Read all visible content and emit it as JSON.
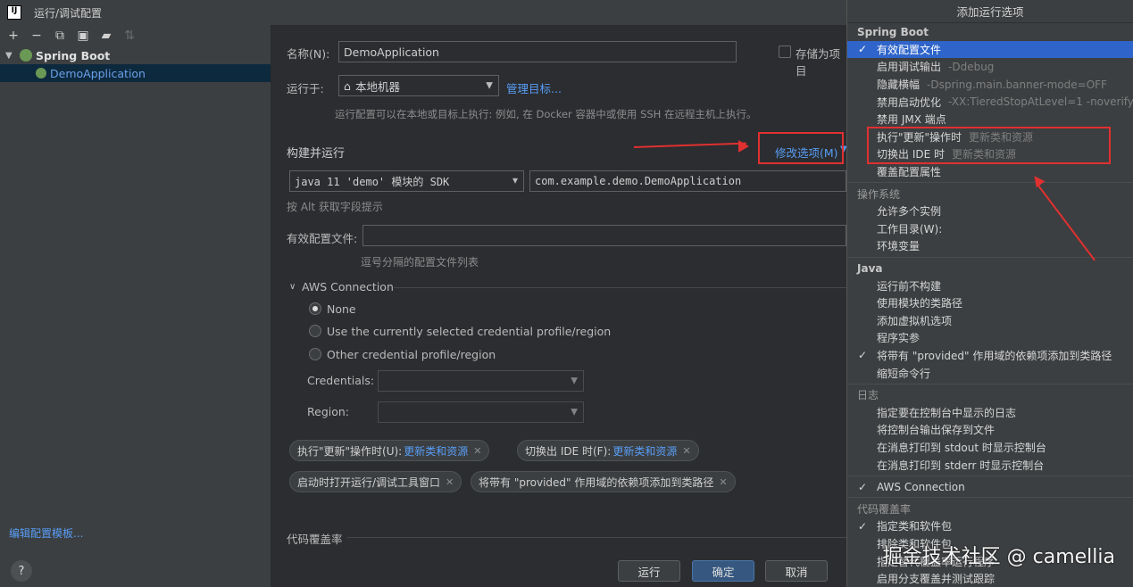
{
  "window": {
    "title": "运行/调试配置"
  },
  "toolbar": {
    "icons": [
      "plus-icon",
      "minus-icon",
      "copy-icon",
      "save-icon",
      "folder-add-icon",
      "sort-icon"
    ]
  },
  "tree": {
    "group_label": "Spring Boot",
    "child_label": "DemoApplication"
  },
  "left_footer": {
    "edit_templates": "编辑配置模板...",
    "help": "?"
  },
  "form": {
    "name_label": "名称(N):",
    "name_value": "DemoApplication",
    "store_label": "存储为项目",
    "run_on_label": "运行于:",
    "run_on_value": "本地机器",
    "manage_targets": "管理目标...",
    "run_on_hint": "运行配置可以在本地或目标上执行: 例如, 在 Docker 容器中或使用 SSH 在远程主机上执行。",
    "build_run_title": "构建并运行",
    "modify_options": "修改选项(M)",
    "sdk_value": "java 11 'demo' 模块的 SDK",
    "main_class_value": "com.example.demo.DemoApplication",
    "alt_hint": "按 Alt 获取字段提示",
    "profiles_label": "有效配置文件:",
    "profiles_hint": "逗号分隔的配置文件列表",
    "aws_title": "AWS Connection",
    "aws_none": "None",
    "aws_current": "Use the currently selected credential profile/region",
    "aws_other": "Other credential profile/region",
    "credentials_label": "Credentials:",
    "region_label": "Region:",
    "chips": {
      "update_action_label": "执行\"更新\"操作时(U):",
      "update_action_value": "更新类和资源",
      "frame_deactivation_label": "切换出 IDE 时(F):",
      "frame_deactivation_value": "更新类和资源",
      "open_tool_window": "启动时打开运行/调试工具窗口",
      "provided_scope": "将带有 \"provided\" 作用域的依赖项添加到类路径"
    },
    "coverage_title": "代码覆盖率"
  },
  "buttons": {
    "run": "运行",
    "ok": "确定",
    "cancel": "取消"
  },
  "popup": {
    "header": "添加运行选项",
    "groups": [
      {
        "title": "Spring Boot",
        "bold": true,
        "items": [
          {
            "label": "有效配置文件",
            "checked": true,
            "selected": true,
            "hint": ""
          },
          {
            "label": "启用调试输出",
            "checked": false,
            "hint": "-Ddebug"
          },
          {
            "label": "隐藏横幅",
            "checked": false,
            "hint": "-Dspring.main.banner-mode=OFF"
          },
          {
            "label": "禁用启动优化",
            "checked": false,
            "hint": "-XX:TieredStopAtLevel=1 -noverify"
          },
          {
            "label": "禁用 JMX 端点",
            "checked": false,
            "hint": ""
          },
          {
            "label": "执行\"更新\"操作时",
            "checked": false,
            "hint": "更新类和资源"
          },
          {
            "label": "切换出 IDE 时",
            "checked": false,
            "hint": "更新类和资源"
          },
          {
            "label": "覆盖配置属性",
            "checked": false,
            "hint": ""
          }
        ]
      },
      {
        "title": "操作系统",
        "bold": false,
        "items": [
          {
            "label": "允许多个实例",
            "checked": false,
            "hint": ""
          },
          {
            "label": "工作目录(W):",
            "checked": false,
            "hint": ""
          },
          {
            "label": "环境变量",
            "checked": false,
            "hint": ""
          }
        ]
      },
      {
        "title": "Java",
        "bold": true,
        "items": [
          {
            "label": "运行前不构建",
            "checked": false,
            "hint": ""
          },
          {
            "label": "使用模块的类路径",
            "checked": false,
            "hint": ""
          },
          {
            "label": "添加虚拟机选项",
            "checked": false,
            "hint": ""
          },
          {
            "label": "程序实参",
            "checked": false,
            "hint": ""
          },
          {
            "label": "将带有 \"provided\" 作用域的依赖项添加到类路径",
            "checked": true,
            "hint": ""
          },
          {
            "label": "缩短命令行",
            "checked": false,
            "hint": ""
          }
        ]
      },
      {
        "title": "日志",
        "bold": false,
        "items": [
          {
            "label": "指定要在控制台中显示的日志",
            "checked": false,
            "hint": ""
          },
          {
            "label": "将控制台输出保存到文件",
            "checked": false,
            "hint": ""
          },
          {
            "label": "在消息打印到 stdout 时显示控制台",
            "checked": false,
            "hint": ""
          },
          {
            "label": "在消息打印到 stderr 时显示控制台",
            "checked": false,
            "hint": ""
          }
        ]
      },
      {
        "title": "",
        "bold": false,
        "items": [
          {
            "label": "AWS Connection",
            "checked": true,
            "hint": ""
          }
        ]
      },
      {
        "title": "代码覆盖率",
        "bold": false,
        "items": [
          {
            "label": "指定类和软件包",
            "checked": true,
            "hint": ""
          },
          {
            "label": "排除类和软件包",
            "checked": false,
            "hint": ""
          },
          {
            "label": "指定替代覆盖率运行程序",
            "checked": false,
            "hint": ""
          },
          {
            "label": "启用分支覆盖并测试跟踪",
            "checked": false,
            "hint": ""
          }
        ]
      }
    ]
  },
  "watermark": "掘金技术社区 @ camellia",
  "colors": {
    "accent": "#2f65ca",
    "link": "#589df6",
    "annotation": "#e03030"
  }
}
